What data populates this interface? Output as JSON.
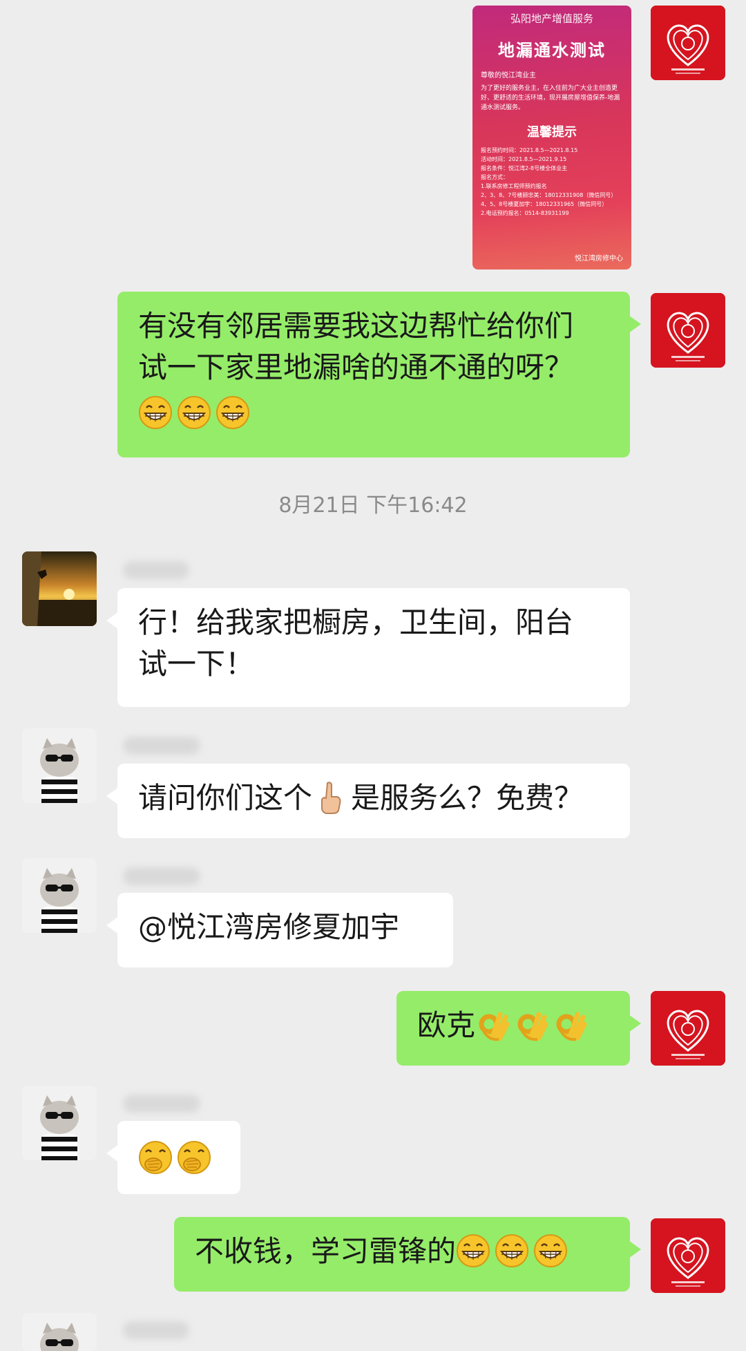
{
  "poster": {
    "company": "弘阳地产增值服务",
    "title": "地漏通水测试",
    "greeting": "尊敬的悦江湾业主",
    "body": "为了更好的服务业主，在入住前为广大业主创造更好、更舒适的生活环境，现开展房屋增值保养-地漏通水测试服务。",
    "tip_title": "温馨提示",
    "lines": [
      "报名预约时间：2021.8.5—2021.8.15",
      "活动时间：2021.8.5—2021.9.15",
      "报名条件：悦江湾2-8号楼全体业主",
      "报名方式：",
      "1.联系房修工程师预约报名",
      "2、3、8、7号楼顾忠美：18012331908（微信同号）",
      "4、5、8号楼夏加宇：18012331965（微信同号）",
      "2.电话预约报名：0514-83931199"
    ],
    "center": "悦江湾房修中心"
  },
  "messages": {
    "m1": {
      "line1": "有没有邻居需要我这边帮忙给你们",
      "line2": "试一下家里地漏啥的通不通的呀？"
    },
    "timestamp": "8月21日 下午16:42",
    "m2": {
      "line1": "行！给我家把橱房，卫生间，阳台",
      "line2": "试一下！"
    },
    "m3": {
      "before": "请问你们这个",
      "after": "是服务么？免费？"
    },
    "m4": {
      "text": "@悦江湾房修夏加宇"
    },
    "m5": {
      "text": "欧克"
    },
    "m7": {
      "text": "不收钱，学习雷锋的"
    }
  },
  "icons": {
    "grin": "grinning-face-icon",
    "point_up": "point-up-icon",
    "ok_hand": "ok-hand-icon",
    "giggle": "hand-over-mouth-icon",
    "self_avatar": "red-heart-logo-icon"
  },
  "colors": {
    "green_bubble": "#95ec69",
    "white_bubble": "#ffffff",
    "background": "#ededed",
    "self_avatar": "#d5141f"
  }
}
